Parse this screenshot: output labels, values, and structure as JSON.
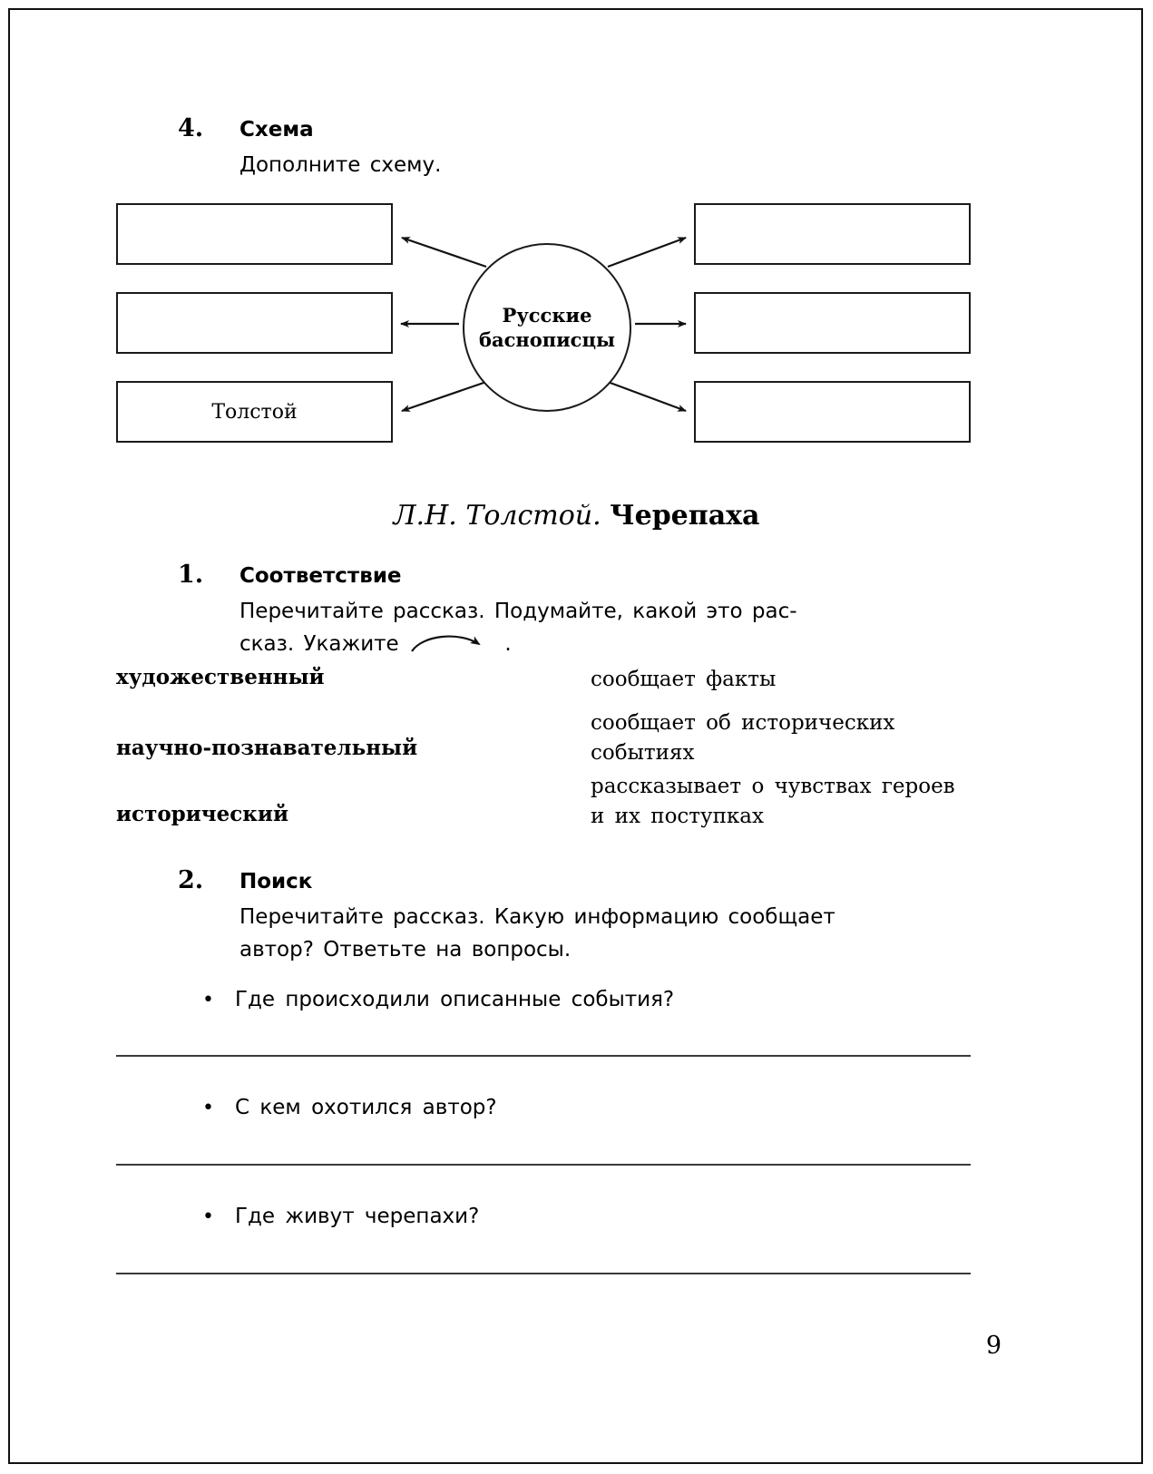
{
  "page": {
    "number": "9"
  },
  "exercise_scheme": {
    "number": "4.",
    "title": "Схема",
    "instruction": "Дополните схему."
  },
  "scheme": {
    "center_label_line1": "Русские",
    "center_label_line2": "баснописцы",
    "boxes": [
      {
        "id": "left-1",
        "label": ""
      },
      {
        "id": "left-2",
        "label": ""
      },
      {
        "id": "left-3",
        "label": "Толстой"
      },
      {
        "id": "right-1",
        "label": ""
      },
      {
        "id": "right-2",
        "label": ""
      },
      {
        "id": "right-3",
        "label": ""
      }
    ]
  },
  "story_title": {
    "author": "Л.Н. Толстой.",
    "work": "Черепаха"
  },
  "exercise_matching": {
    "number": "1.",
    "title": "Соответствие",
    "instruction_line1": "Перечитайте  рассказ.  Подумайте,  какой  это  рас-",
    "instruction_line2": "сказ.  Укажите",
    "instruction_line2_tail": ".",
    "left_items": [
      "художественный",
      "научно-познавательный",
      "исторический"
    ],
    "right_items": [
      "сообщает  факты",
      "сообщает  об  исторических событиях",
      "рассказывает  о  чувствах героев  и  их  поступках"
    ]
  },
  "exercise_search": {
    "number": "2.",
    "title": "Поиск",
    "instruction_line1": "Перечитайте  рассказ.  Какую  информацию  сообщает",
    "instruction_line2": "автор?  Ответьте  на  вопросы.",
    "bullet": "•",
    "questions": [
      "Где  происходили  описанные  события?",
      "С  кем  охотился  автор?",
      "Где  живут  черепахи?"
    ]
  }
}
